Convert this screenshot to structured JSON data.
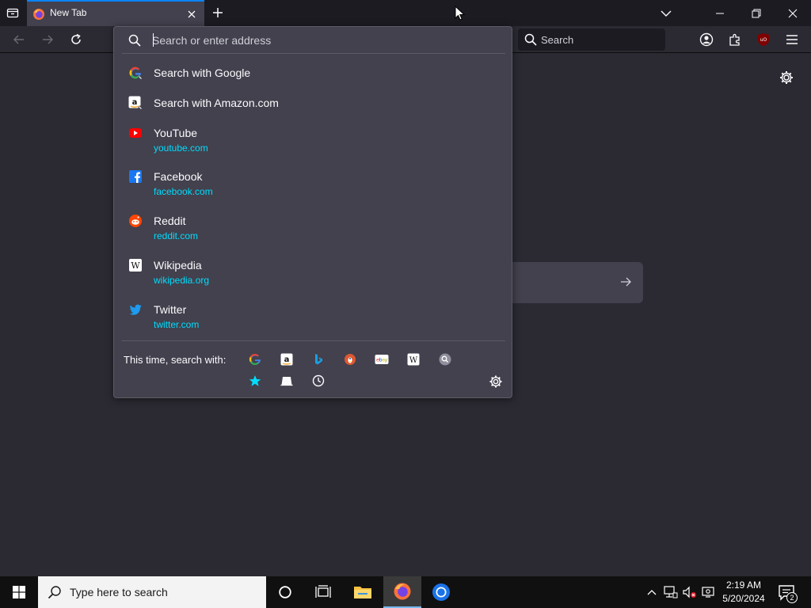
{
  "tab": {
    "title": "New Tab"
  },
  "navbar": {
    "search_placeholder": "Search"
  },
  "urlbar": {
    "placeholder": "Search or enter address",
    "results": [
      {
        "title": "Search with Google",
        "url": "",
        "icon": "google-icon"
      },
      {
        "title": "Search with Amazon.com",
        "url": "",
        "icon": "amazon-icon"
      },
      {
        "title": "YouTube",
        "url": "youtube.com",
        "icon": "youtube-icon"
      },
      {
        "title": "Facebook",
        "url": "facebook.com",
        "icon": "facebook-icon"
      },
      {
        "title": "Reddit",
        "url": "reddit.com",
        "icon": "reddit-icon"
      },
      {
        "title": "Wikipedia",
        "url": "wikipedia.org",
        "icon": "wikipedia-icon"
      },
      {
        "title": "Twitter",
        "url": "twitter.com",
        "icon": "twitter-icon"
      }
    ],
    "one_off_label": "This time, search with:",
    "engines": [
      "google",
      "amazon",
      "bing",
      "duckduckgo",
      "ebay",
      "wikipedia",
      "search",
      "bookmarks",
      "tabs",
      "history"
    ]
  },
  "taskbar": {
    "search_placeholder": "Type here to search",
    "time": "2:19 AM",
    "date": "5/20/2024",
    "notification_count": "2"
  },
  "colors": {
    "accent": "#0a84ff",
    "url": "#00ddff",
    "popup": "#42414d",
    "background": "#2b2a33"
  }
}
